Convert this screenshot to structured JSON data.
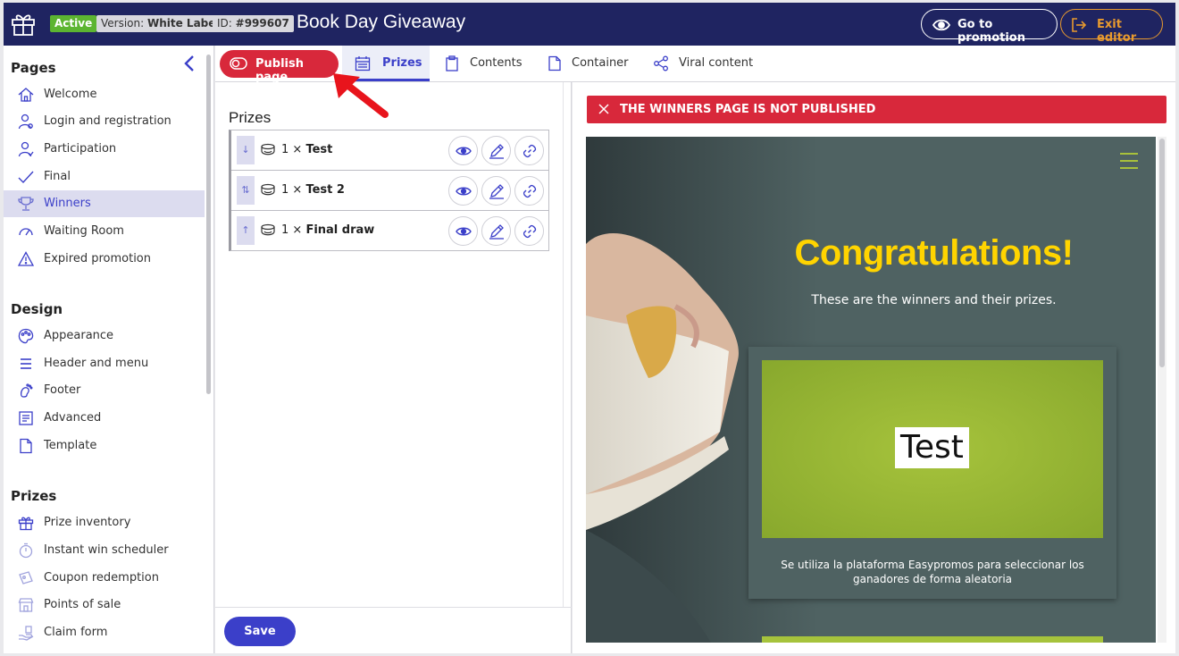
{
  "header": {
    "status_badge": "Active",
    "version_label": "Version: ",
    "version_value": "White Label",
    "id_label": "ID: ",
    "id_value": "#999607",
    "title": "Book Day Giveaway",
    "go_to_promotion": "Go to promotion",
    "exit_editor": "Exit editor"
  },
  "sidebar": {
    "pages_title": "Pages",
    "pages": [
      {
        "label": "Welcome",
        "icon": "home-icon"
      },
      {
        "label": "Login and registration",
        "icon": "user-icon"
      },
      {
        "label": "Participation",
        "icon": "user-check-icon"
      },
      {
        "label": "Final",
        "icon": "check-icon"
      },
      {
        "label": "Winners",
        "icon": "trophy-icon",
        "active": true
      },
      {
        "label": "Waiting Room",
        "icon": "gauge-icon"
      },
      {
        "label": "Expired promotion",
        "icon": "warning-icon"
      }
    ],
    "design_title": "Design",
    "design": [
      {
        "label": "Appearance",
        "icon": "palette-icon"
      },
      {
        "label": "Header and menu",
        "icon": "menu-icon"
      },
      {
        "label": "Footer",
        "icon": "foot-icon"
      },
      {
        "label": "Advanced",
        "icon": "code-icon"
      },
      {
        "label": "Template",
        "icon": "file-icon"
      }
    ],
    "prizes_title": "Prizes",
    "prizes": [
      {
        "label": "Prize inventory",
        "icon": "gift-icon"
      },
      {
        "label": "Instant win scheduler",
        "icon": "stopwatch-icon"
      },
      {
        "label": "Coupon redemption",
        "icon": "coupon-icon"
      },
      {
        "label": "Points of sale",
        "icon": "store-icon"
      },
      {
        "label": "Claim form",
        "icon": "hand-icon"
      }
    ]
  },
  "tabs": {
    "publish_page": "Publish page",
    "items": [
      {
        "label": "Prizes",
        "icon": "calendar-icon",
        "active": true
      },
      {
        "label": "Contents",
        "icon": "clipboard-icon"
      },
      {
        "label": "Container",
        "icon": "file-icon"
      },
      {
        "label": "Viral content",
        "icon": "share-icon"
      }
    ]
  },
  "prizes_panel": {
    "heading": "Prizes",
    "rows": [
      {
        "qty": "1 × ",
        "name": "Test",
        "handle": "↓"
      },
      {
        "qty": "1 × ",
        "name": "Test 2",
        "handle": "⇅"
      },
      {
        "qty": "1 × ",
        "name": "Final draw",
        "handle": "↑"
      }
    ],
    "save_label": "Save"
  },
  "preview": {
    "alert": "THE WINNERS PAGE IS NOT PUBLISHED",
    "congrats": "Congratulations!",
    "subtitle": "These are the winners and their prizes.",
    "card_prize": "Test",
    "card_description": "Se utiliza la plataforma Easypromos para seleccionar los ganadores de forma aleatoria"
  },
  "colors": {
    "topbar": "#1f2461",
    "accent": "#3b3fc9",
    "danger": "#d8283b",
    "active_green": "#5cb531",
    "exit_orange": "#e89a2e",
    "congrats_yellow": "#ffd400",
    "prize_green": "#a6c33c",
    "preview_bg": "#4f6262"
  }
}
